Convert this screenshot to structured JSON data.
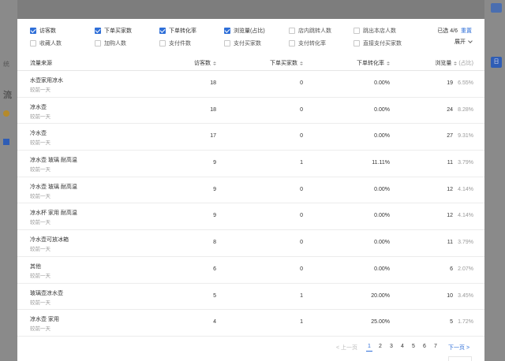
{
  "background": {
    "left_fragments": [
      "流",
      "统",
      "流"
    ],
    "right_button": "日"
  },
  "filters": [
    {
      "label": "访客数",
      "checked": true
    },
    {
      "label": "下单买家数",
      "checked": true
    },
    {
      "label": "下单转化率",
      "checked": true
    },
    {
      "label": "浏览量(占比)",
      "checked": true
    },
    {
      "label": "店内跳转人数",
      "checked": false
    },
    {
      "label": "跳出本店人数",
      "checked": false
    },
    {
      "label": "收藏人数",
      "checked": false
    },
    {
      "label": "加购人数",
      "checked": false
    },
    {
      "label": "支付件数",
      "checked": false
    },
    {
      "label": "支付买家数",
      "checked": false
    },
    {
      "label": "支付转化率",
      "checked": false
    },
    {
      "label": "直接支付买家数",
      "checked": false
    }
  ],
  "selected_count": "已选 4/6",
  "reset_label": "重置",
  "expand_label": "展开",
  "table": {
    "headers": [
      "流量来源",
      "访客数",
      "下单买家数",
      "下单转化率",
      "浏览量",
      "(占比)"
    ],
    "rows": [
      {
        "name": "水壶家用凉水",
        "sub": "较前一天",
        "visitors": "18",
        "buyers": "0",
        "conversion": "0.00%",
        "views": "19",
        "share": "6.55%"
      },
      {
        "name": "凉水壶",
        "sub": "较前一天",
        "visitors": "18",
        "buyers": "0",
        "conversion": "0.00%",
        "views": "24",
        "share": "8.28%"
      },
      {
        "name": "冷水壶",
        "sub": "较前一天",
        "visitors": "17",
        "buyers": "0",
        "conversion": "0.00%",
        "views": "27",
        "share": "9.31%"
      },
      {
        "name": "凉水壶 玻璃 耐高温",
        "sub": "较前一天",
        "visitors": "9",
        "buyers": "1",
        "conversion": "11.11%",
        "views": "11",
        "share": "3.79%"
      },
      {
        "name": "冷水壶 玻璃 耐高温",
        "sub": "较前一天",
        "visitors": "9",
        "buyers": "0",
        "conversion": "0.00%",
        "views": "12",
        "share": "4.14%"
      },
      {
        "name": "凉水杯 家用 耐高温",
        "sub": "较前一天",
        "visitors": "9",
        "buyers": "0",
        "conversion": "0.00%",
        "views": "12",
        "share": "4.14%"
      },
      {
        "name": "冷水壶可放冰箱",
        "sub": "较前一天",
        "visitors": "8",
        "buyers": "0",
        "conversion": "0.00%",
        "views": "11",
        "share": "3.79%"
      },
      {
        "name": "其他",
        "sub": "较前一天",
        "visitors": "6",
        "buyers": "0",
        "conversion": "0.00%",
        "views": "6",
        "share": "2.07%"
      },
      {
        "name": "玻璃壶凉水壶",
        "sub": "较前一天",
        "visitors": "5",
        "buyers": "1",
        "conversion": "20.00%",
        "views": "10",
        "share": "3.45%"
      },
      {
        "name": "凉水壶 家用",
        "sub": "较前一天",
        "visitors": "4",
        "buyers": "1",
        "conversion": "25.00%",
        "views": "5",
        "share": "1.72%"
      }
    ]
  },
  "pagination": {
    "prev": "< 上一页",
    "pages": [
      "1",
      "2",
      "3",
      "4",
      "5",
      "6",
      "7"
    ],
    "current": "1",
    "next": "下一页 >"
  },
  "colors": {
    "accent": "#2f6fd8",
    "overlay": "#7d7d7d",
    "muted_text": "#999999"
  }
}
